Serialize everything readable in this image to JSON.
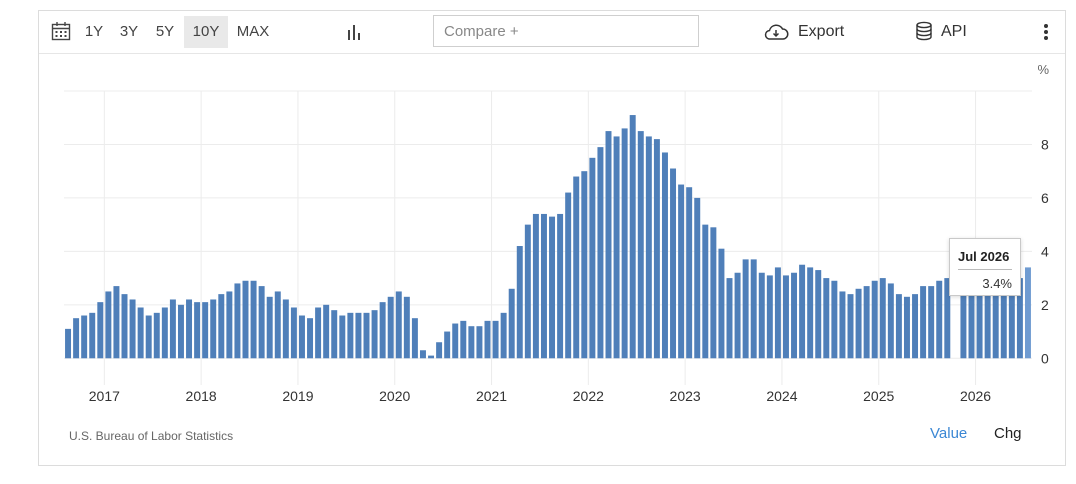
{
  "toolbar": {
    "ranges": [
      {
        "label": "1Y",
        "active": false
      },
      {
        "label": "3Y",
        "active": false
      },
      {
        "label": "5Y",
        "active": false
      },
      {
        "label": "10Y",
        "active": true
      },
      {
        "label": "MAX",
        "active": false
      }
    ],
    "compare_placeholder": "Compare +",
    "export_label": "Export",
    "api_label": "API"
  },
  "footer": {
    "source": "U.S. Bureau of Labor Statistics",
    "value_label": "Value",
    "chg_label": "Chg"
  },
  "tooltip": {
    "date": "Jul 2026",
    "value": "3.4%"
  },
  "colors": {
    "bar": "#4f7fb9",
    "bar_highlight": "#6f9bd1",
    "value_link": "#3b87d4"
  },
  "chart_data": {
    "type": "bar",
    "unit": "%",
    "x_start": "2016-08",
    "x_end": "2026-07",
    "x_tick_labels": [
      "2017",
      "2018",
      "2019",
      "2020",
      "2021",
      "2022",
      "2023",
      "2024",
      "2025",
      "2026"
    ],
    "ylim": [
      -1,
      10
    ],
    "y_ticks": [
      0,
      2,
      4,
      6,
      8
    ],
    "grid": true,
    "values": [
      1.1,
      1.5,
      1.6,
      1.7,
      2.1,
      2.5,
      2.7,
      2.4,
      2.2,
      1.9,
      1.6,
      1.7,
      1.9,
      2.2,
      2.0,
      2.2,
      2.1,
      2.1,
      2.2,
      2.4,
      2.5,
      2.8,
      2.9,
      2.9,
      2.7,
      2.3,
      2.5,
      2.2,
      1.9,
      1.6,
      1.5,
      1.9,
      2.0,
      1.8,
      1.6,
      1.7,
      1.7,
      1.7,
      1.8,
      2.1,
      2.3,
      2.5,
      2.3,
      1.5,
      0.3,
      0.1,
      0.6,
      1.0,
      1.3,
      1.4,
      1.2,
      1.2,
      1.4,
      1.4,
      1.7,
      2.6,
      4.2,
      5.0,
      5.4,
      5.4,
      5.3,
      5.4,
      6.2,
      6.8,
      7.0,
      7.5,
      7.9,
      8.5,
      8.3,
      8.6,
      9.1,
      8.5,
      8.3,
      8.2,
      7.7,
      7.1,
      6.5,
      6.4,
      6.0,
      5.0,
      4.9,
      4.1,
      3.0,
      3.2,
      3.7,
      3.7,
      3.2,
      3.1,
      3.4,
      3.1,
      3.2,
      3.5,
      3.4,
      3.3,
      3.0,
      2.9,
      2.5,
      2.4,
      2.6,
      2.7,
      2.9,
      3.0,
      2.8,
      2.4,
      2.3,
      2.4,
      2.7,
      2.7,
      2.9,
      3.0,
      null,
      3.0,
      3.0,
      3.0,
      3.0,
      3.0,
      3.0,
      3.0,
      3.0,
      3.4
    ]
  }
}
